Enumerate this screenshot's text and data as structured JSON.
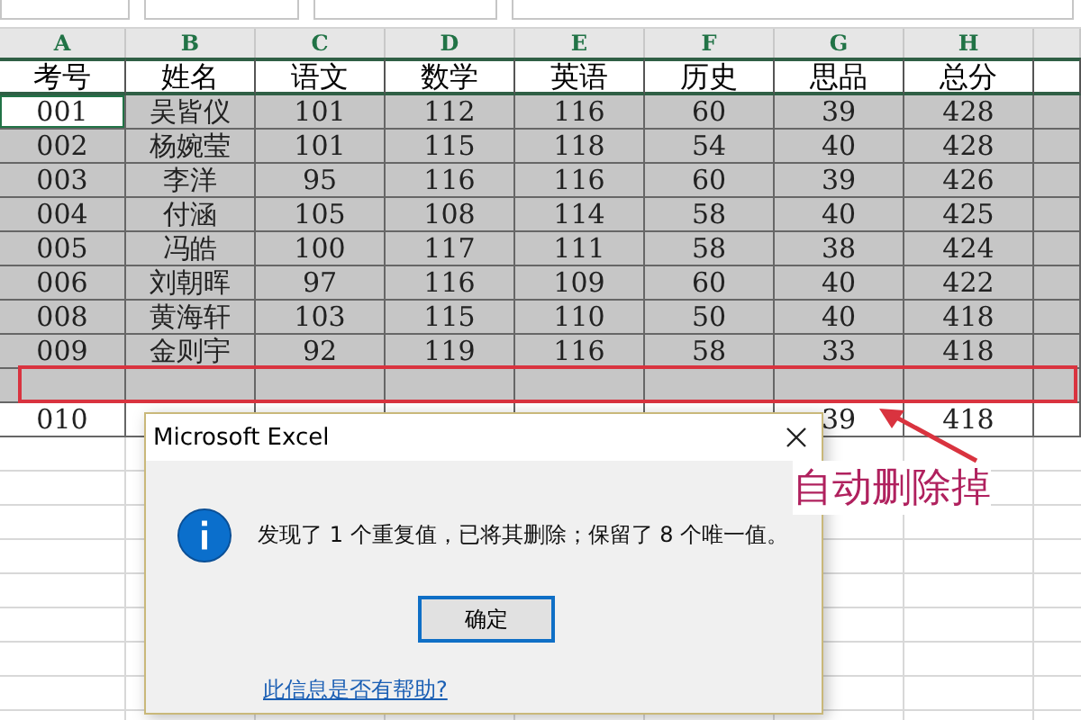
{
  "columns": [
    "A",
    "B",
    "C",
    "D",
    "E",
    "F",
    "G",
    "H"
  ],
  "header": [
    "考号",
    "姓名",
    "语文",
    "数学",
    "英语",
    "历史",
    "思品",
    "总分"
  ],
  "rows": [
    {
      "cells": [
        "001",
        "吴皆仪",
        "101",
        "112",
        "116",
        "60",
        "39",
        "428"
      ],
      "selected": true,
      "cursor": true,
      "highlighted": false
    },
    {
      "cells": [
        "002",
        "杨婉莹",
        "101",
        "115",
        "118",
        "54",
        "40",
        "428"
      ],
      "selected": true,
      "cursor": false,
      "highlighted": false
    },
    {
      "cells": [
        "003",
        "李洋",
        "95",
        "116",
        "116",
        "60",
        "39",
        "426"
      ],
      "selected": true,
      "cursor": false,
      "highlighted": false
    },
    {
      "cells": [
        "004",
        "付涵",
        "105",
        "108",
        "114",
        "58",
        "40",
        "425"
      ],
      "selected": true,
      "cursor": false,
      "highlighted": false
    },
    {
      "cells": [
        "005",
        "冯皓",
        "100",
        "117",
        "111",
        "58",
        "38",
        "424"
      ],
      "selected": true,
      "cursor": false,
      "highlighted": false
    },
    {
      "cells": [
        "006",
        "刘朝晖",
        "97",
        "116",
        "109",
        "60",
        "40",
        "422"
      ],
      "selected": true,
      "cursor": false,
      "highlighted": false
    },
    {
      "cells": [
        "008",
        "黄海轩",
        "103",
        "115",
        "110",
        "50",
        "40",
        "418"
      ],
      "selected": true,
      "cursor": false,
      "highlighted": false
    },
    {
      "cells": [
        "009",
        "金则宇",
        "92",
        "119",
        "116",
        "58",
        "33",
        "418"
      ],
      "selected": true,
      "cursor": false,
      "highlighted": false
    },
    {
      "cells": [],
      "selected": true,
      "cursor": false,
      "highlighted": true
    },
    {
      "cells": [
        "010",
        null,
        null,
        null,
        null,
        null,
        "39",
        "418"
      ],
      "selected": false,
      "cursor": false,
      "highlighted": false
    }
  ],
  "dialog": {
    "title": "Microsoft Excel",
    "message": "发现了 1 个重复值，已将其删除；保留了 8 个唯一值。",
    "button": "确定",
    "link": "此信息是否有帮助?"
  },
  "annotation": {
    "text": "自动删除掉"
  }
}
